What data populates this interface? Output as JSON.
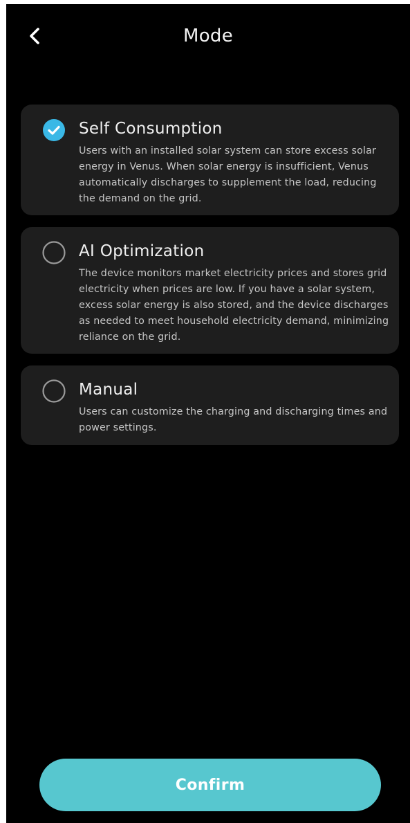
{
  "header": {
    "back_icon": "chevron-left-icon",
    "title": "Mode"
  },
  "modes": [
    {
      "title": "Self Consumption",
      "description": "Users with an installed solar system can store excess solar energy in Venus. When solar energy is insufficient, Venus automatically discharges to supplement the load, reducing the demand on the grid.",
      "selected": true
    },
    {
      "title": "AI Optimization",
      "description": "The device monitors market electricity prices and stores grid electricity when prices are low. If you have a solar system, excess solar energy is also stored, and the device discharges as needed to meet household electricity demand, minimizing reliance on the grid.",
      "selected": false
    },
    {
      "title": "Manual",
      "description": "Users can customize the charging and discharging times and power settings.",
      "selected": false
    }
  ],
  "confirm_label": "Confirm",
  "colors": {
    "background": "#000000",
    "card": "#1e1e1e",
    "accent": "#57c7cf",
    "check_fill": "#3ab8e6",
    "radio_ring": "#9a9a9a"
  }
}
